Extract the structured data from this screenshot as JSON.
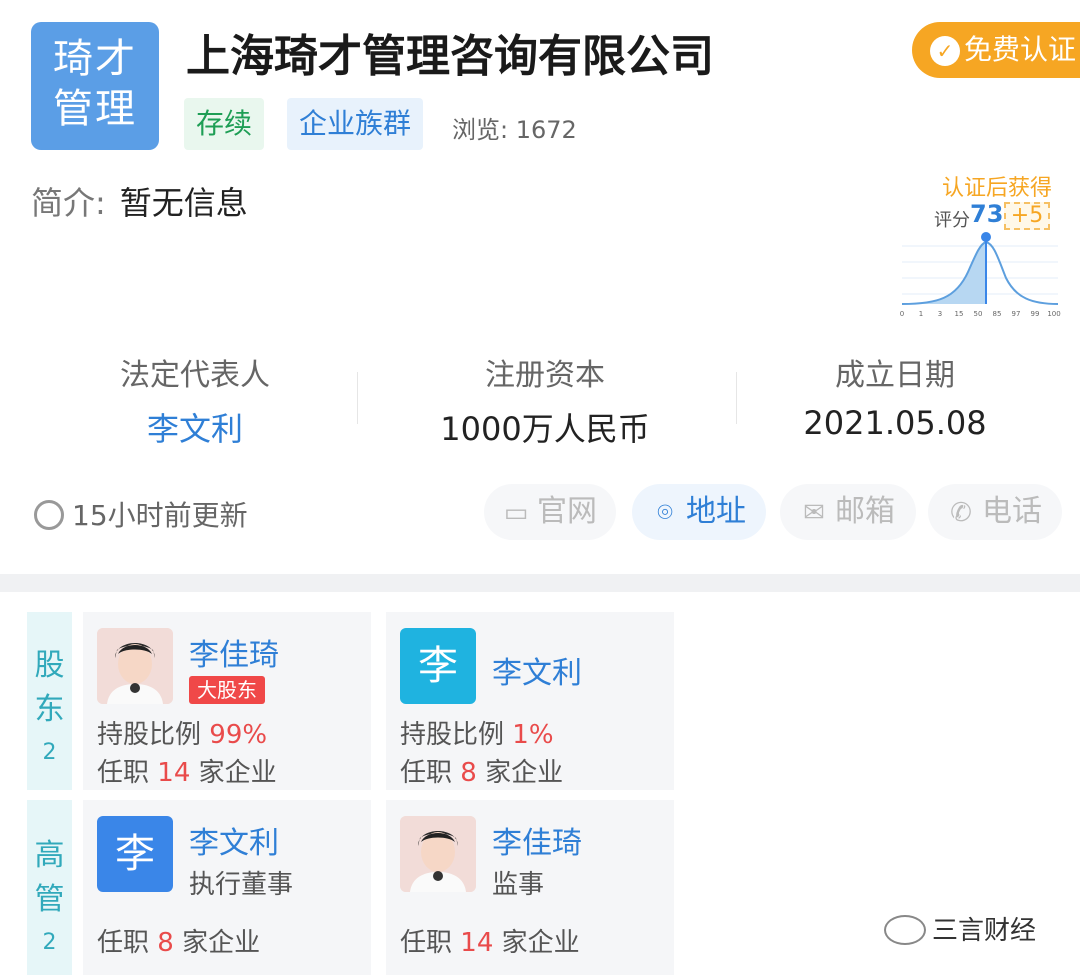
{
  "company": {
    "logo_line1": "琦才",
    "logo_line2": "管理",
    "name": "上海琦才管理咨询有限公司",
    "status_tag": "存续",
    "group_tag": "企业族群",
    "views_label": "浏览: 1672",
    "intro_label": "简介:",
    "intro_value": "暂无信息"
  },
  "certify": {
    "label": "免费认证"
  },
  "score_card": {
    "gain_label": "认证后获得",
    "score_label": "评分",
    "score_value": "73",
    "bonus": "+5",
    "ticks": [
      "0",
      "1",
      "3",
      "15",
      "50",
      "85",
      "97",
      "99",
      "100"
    ]
  },
  "stats": {
    "legal_rep_label": "法定代表人",
    "legal_rep_value": "李文利",
    "capital_label": "注册资本",
    "capital_value": "1000万人民币",
    "founded_label": "成立日期",
    "founded_value": "2021.05.08"
  },
  "update_text": "15小时前更新",
  "contact": {
    "website": "官网",
    "address": "地址",
    "email": "邮箱",
    "phone": "电话"
  },
  "shareholders": {
    "label_top": "股",
    "label_bottom": "东",
    "count": "2",
    "items": [
      {
        "name": "李佳琦",
        "badge": "大股东",
        "share_label": "持股比例",
        "share_value": "99%",
        "job_prefix": "任职",
        "job_count": "14",
        "job_suffix": "家企业"
      },
      {
        "name": "李文利",
        "avatar_letter": "李",
        "share_label": "持股比例",
        "share_value": "1%",
        "job_prefix": "任职",
        "job_count": "8",
        "job_suffix": "家企业"
      }
    ]
  },
  "executives": {
    "label_top": "高",
    "label_bottom": "管",
    "count": "2",
    "items": [
      {
        "name": "李文利",
        "avatar_letter": "李",
        "role": "执行董事",
        "job_prefix": "任职",
        "job_count": "8",
        "job_suffix": "家企业"
      },
      {
        "name": "李佳琦",
        "role": "监事",
        "job_prefix": "任职",
        "job_count": "14",
        "job_suffix": "家企业"
      }
    ]
  },
  "watermark": "三言财经"
}
